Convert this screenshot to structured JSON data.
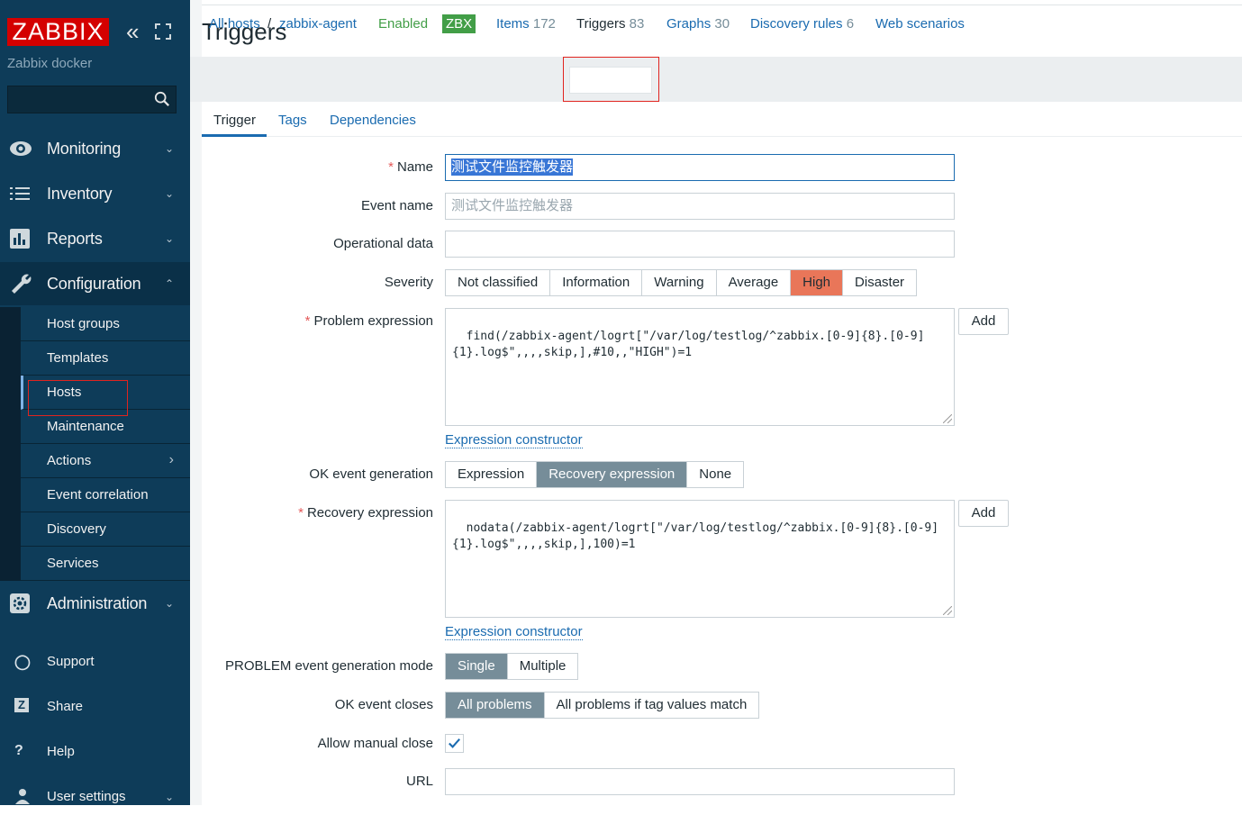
{
  "sidebar": {
    "brand": "ZABBIX",
    "server_name": "Zabbix docker",
    "search_placeholder": "",
    "menu": {
      "monitoring": "Monitoring",
      "inventory": "Inventory",
      "reports": "Reports",
      "configuration": "Configuration",
      "administration": "Administration"
    },
    "config_items": [
      "Host groups",
      "Templates",
      "Hosts",
      "Maintenance",
      "Actions",
      "Event correlation",
      "Discovery",
      "Services"
    ],
    "bottom": {
      "support": "Support",
      "share": "Share",
      "help": "Help",
      "user_settings": "User settings"
    }
  },
  "page": {
    "title": "Triggers"
  },
  "hostbar": {
    "all_hosts": "All hosts",
    "sep": "/",
    "host": "zabbix-agent",
    "enabled": "Enabled",
    "zbx": "ZBX",
    "items_label": "Items",
    "items_count": "172",
    "triggers_label": "Triggers",
    "triggers_count": "83",
    "graphs_label": "Graphs",
    "graphs_count": "30",
    "discovery_label": "Discovery rules",
    "discovery_count": "6",
    "web_label": "Web scenarios"
  },
  "subtabs": {
    "trigger": "Trigger",
    "tags": "Tags",
    "dependencies": "Dependencies"
  },
  "form": {
    "name_label": "Name",
    "name_value": "测试文件监控触发器",
    "event_name_label": "Event name",
    "event_name_placeholder": "测试文件监控触发器",
    "opdata_label": "Operational data",
    "opdata_value": "",
    "severity_label": "Severity",
    "severity_options": [
      "Not classified",
      "Information",
      "Warning",
      "Average",
      "High",
      "Disaster"
    ],
    "severity_selected": "High",
    "problem_expr_label": "Problem expression",
    "problem_expr_value": "find(/zabbix-agent/logrt[\"/var/log/testlog/^zabbix.[0-9]{8}.[0-9]{1}.log$\",,,,skip,],#10,,\"HIGH\")=1",
    "add_label": "Add",
    "expr_constructor": "Expression constructor",
    "ok_event_gen_label": "OK event generation",
    "ok_event_gen_options": [
      "Expression",
      "Recovery expression",
      "None"
    ],
    "ok_event_gen_selected": "Recovery expression",
    "recovery_expr_label": "Recovery expression",
    "recovery_expr_value": "nodata(/zabbix-agent/logrt[\"/var/log/testlog/^zabbix.[0-9]{8}.[0-9]{1}.log$\",,,,skip,],100)=1",
    "problem_mode_label": "PROBLEM event generation mode",
    "problem_mode_options": [
      "Single",
      "Multiple"
    ],
    "problem_mode_selected": "Single",
    "ok_closes_label": "OK event closes",
    "ok_closes_options": [
      "All problems",
      "All problems if tag values match"
    ],
    "ok_closes_selected": "All problems",
    "manual_close_label": "Allow manual close",
    "manual_close_checked": true,
    "url_label": "URL",
    "url_value": ""
  }
}
